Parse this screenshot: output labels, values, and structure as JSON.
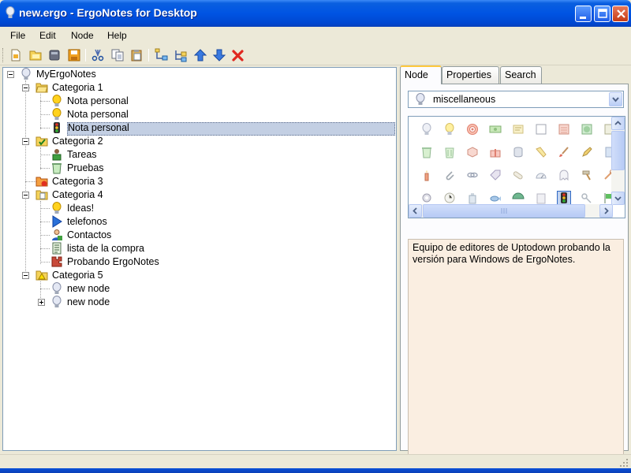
{
  "window": {
    "title": "new.ergo - ErgoNotes for Desktop",
    "icon": "lightbulb-icon"
  },
  "menu": {
    "items": [
      "File",
      "Edit",
      "Node",
      "Help"
    ]
  },
  "toolbar": {
    "buttons": [
      "new-file-icon",
      "open-file-icon",
      "close-file-icon",
      "save-icon",
      "cut-icon",
      "copy-icon",
      "paste-icon",
      "add-node-icon",
      "add-child-node-icon",
      "move-up-icon",
      "move-down-icon",
      "delete-icon"
    ]
  },
  "tree": {
    "root": "MyErgoNotes",
    "cat1": "Categoria 1",
    "cat1_items": [
      "Nota personal",
      "Nota personal",
      "Nota personal"
    ],
    "cat2": "Categoria 2",
    "cat2_items": [
      "Tareas",
      "Pruebas"
    ],
    "cat3": "Categoria 3",
    "cat4": "Categoria 4",
    "cat4_items": [
      "Ideas!",
      "telefonos",
      "Contactos",
      "lista de la compra",
      "Probando ErgoNotes"
    ],
    "cat5": "Categoria 5",
    "cat5_items": [
      "new node",
      "new node"
    ],
    "selected": "Nota personal"
  },
  "tabs": {
    "items": [
      "Node",
      "Properties",
      "Search"
    ],
    "active": "Node"
  },
  "node_panel": {
    "icon_category": "miscellaneous",
    "description": "Equipo de editores de Uptodown probando la versión para Windows de ErgoNotes."
  },
  "colors": {
    "titlebar": "#0054e3",
    "selection": "#c3cfe3",
    "description_bg": "#faeee1",
    "folder": "#f5d35a",
    "bulb": "#ffd21e"
  }
}
